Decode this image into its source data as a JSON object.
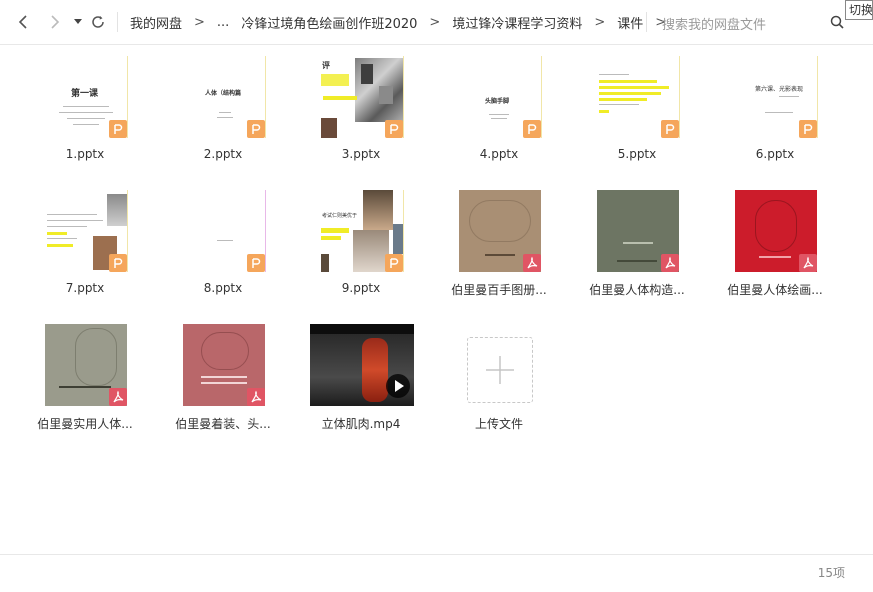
{
  "toolbar": {
    "crumbs": [
      "我的网盘",
      "...",
      "冷锋过境角色绘画创作班2020",
      "境过锋冷课程学习资料",
      "课件"
    ],
    "search_placeholder": "搜索我的网盘文件",
    "tooltip": "切换"
  },
  "files": [
    {
      "name": "1.pptx",
      "type": "pptx",
      "slide_title": "第一课"
    },
    {
      "name": "2.pptx",
      "type": "pptx",
      "slide_title": "人体（结构篇"
    },
    {
      "name": "3.pptx",
      "type": "pptx",
      "slide_title": "评"
    },
    {
      "name": "4.pptx",
      "type": "pptx",
      "slide_title": "头脑手脚"
    },
    {
      "name": "5.pptx",
      "type": "pptx",
      "slide_title": ""
    },
    {
      "name": "6.pptx",
      "type": "pptx",
      "slide_title": "第六课、光影表现"
    },
    {
      "name": "7.pptx",
      "type": "pptx",
      "slide_title": ""
    },
    {
      "name": "8.pptx",
      "type": "pptx",
      "slide_title": ""
    },
    {
      "name": "9.pptx",
      "type": "pptx",
      "slide_title": "考试仁则美优于"
    },
    {
      "name": "伯里曼百手图册...",
      "type": "pdf",
      "cover": "#a98f74"
    },
    {
      "name": "伯里曼人体构造...",
      "type": "pdf",
      "cover": "#6d7563"
    },
    {
      "name": "伯里曼人体绘画...",
      "type": "pdf",
      "cover": "#cc1c2b"
    },
    {
      "name": "伯里曼实用人体...",
      "type": "pdf",
      "cover": "#9a9b8c"
    },
    {
      "name": "伯里曼着装、头...",
      "type": "pdf",
      "cover": "#b9676a"
    },
    {
      "name": "立体肌肉.mp4",
      "type": "mp4"
    }
  ],
  "upload_label": "上传文件",
  "status": {
    "count": "15项"
  },
  "colors": {
    "ppt_badge": "#f5a65b",
    "pdf_badge": "#e05564",
    "highlight": "#f0ec27"
  }
}
